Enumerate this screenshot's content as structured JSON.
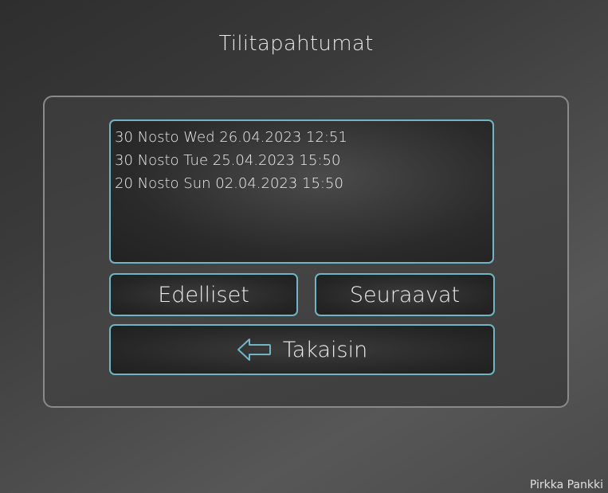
{
  "page": {
    "title": "Tilitapahtumat",
    "footer": "Pirkka Pankki"
  },
  "transactions": [
    "30 Nosto Wed 26.04.2023 12:51",
    "30 Nosto Tue 25.04.2023 15:50",
    "20 Nosto Sun 02.04.2023 15:50"
  ],
  "buttons": {
    "previous": "Edelliset",
    "next": "Seuraavat",
    "back": "Takaisin",
    "back_icon": "arrow-left-icon"
  },
  "colors": {
    "accent": "#6fb6c4"
  }
}
